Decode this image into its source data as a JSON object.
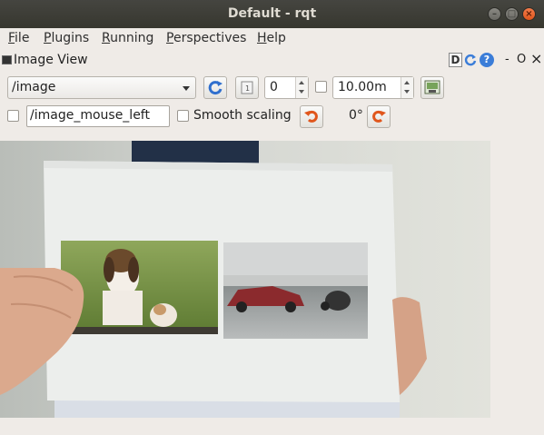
{
  "window": {
    "title": "Default - rqt"
  },
  "menubar": {
    "items": [
      {
        "label": "File",
        "mnemonic": "F",
        "rest": "ile"
      },
      {
        "label": "Plugins",
        "mnemonic": "P",
        "rest": "lugins"
      },
      {
        "label": "Running",
        "mnemonic": "R",
        "rest": "unning"
      },
      {
        "label": "Perspectives",
        "mnemonic": "P",
        "rest": "erspectives"
      },
      {
        "label": "Help",
        "mnemonic": "H",
        "rest": "elp"
      }
    ]
  },
  "dock": {
    "title": "Image View",
    "d_button": "D",
    "help_glyph": "?",
    "minimize": "-",
    "float": "O",
    "close": "×"
  },
  "toolbar": {
    "topic": "/image",
    "zoom_value": "0",
    "max_range": "10.00m",
    "max_range_checked": false
  },
  "toolbar2": {
    "mouse_topic": "/image_mouse_left",
    "mouse_checked": false,
    "smooth_scaling_label": "Smooth scaling",
    "smooth_scaling_checked": false,
    "rotation": "0°"
  },
  "colors": {
    "titlebar": "#3c3b37",
    "accent_orange": "#e0561c",
    "accent_blue": "#3b7dd8"
  }
}
